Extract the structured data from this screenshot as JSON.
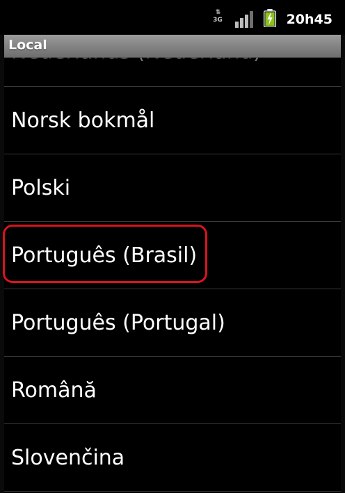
{
  "status_bar": {
    "network_label": "3G",
    "time": "20h45",
    "icons": [
      "data-arrows-icon",
      "signal-strength-icon",
      "battery-charging-icon"
    ],
    "battery_color": "#8bc21c"
  },
  "title_bar": {
    "title": "Local"
  },
  "locale_list": {
    "items": [
      {
        "label": "Nederlands (Nederland)",
        "partial": true
      },
      {
        "label": "Norsk bokmål"
      },
      {
        "label": "Polski"
      },
      {
        "label": "Português (Brasil)",
        "highlighted": true
      },
      {
        "label": "Português (Portugal)"
      },
      {
        "label": "Română"
      },
      {
        "label": "Slovenčina"
      }
    ]
  },
  "colors": {
    "background": "#000000",
    "highlight": "#d8141c",
    "divider": "#3a3a3a"
  }
}
